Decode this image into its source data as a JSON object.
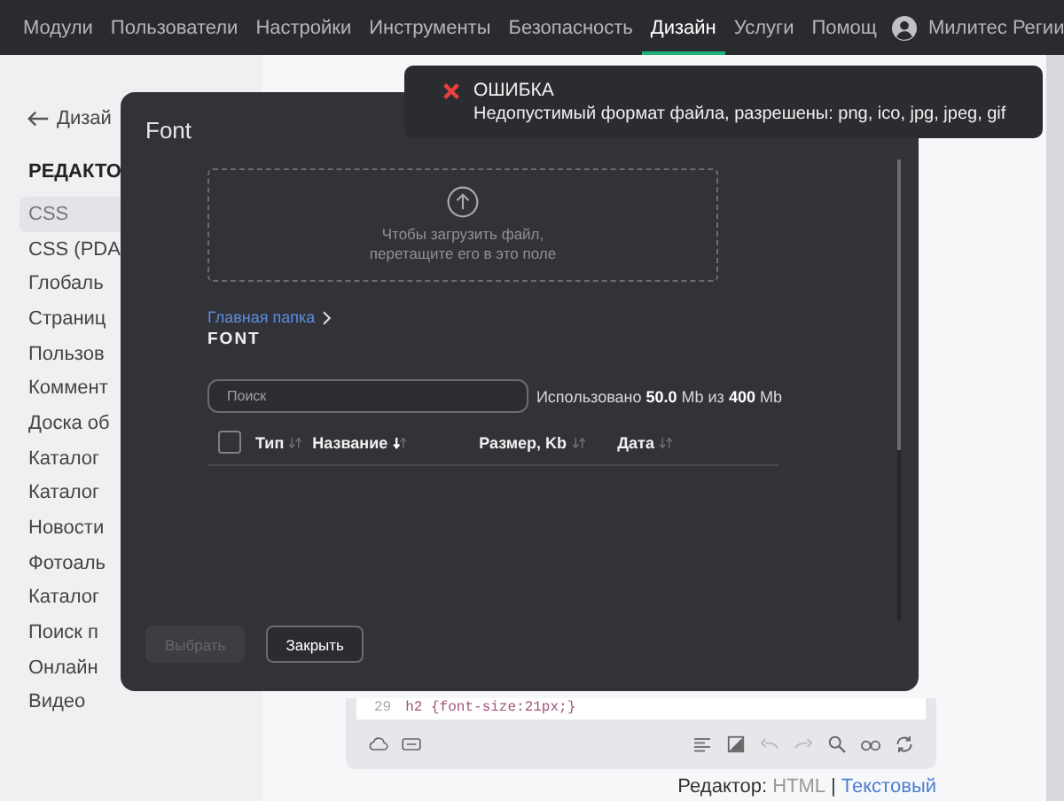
{
  "nav": {
    "items": [
      {
        "label": "Модули",
        "selected": false
      },
      {
        "label": "Пользователи",
        "selected": false
      },
      {
        "label": "Настройки",
        "selected": false
      },
      {
        "label": "Инструменты",
        "selected": false
      },
      {
        "label": "Безопасность",
        "selected": false
      },
      {
        "label": "Дизайн",
        "selected": true
      },
      {
        "label": "Услуги",
        "selected": false
      },
      {
        "label": "Помощ",
        "selected": false
      }
    ],
    "user": {
      "name": "Милитес Регии"
    }
  },
  "back_link": "Дизай",
  "sidebar": {
    "heading": "РЕДАКТО",
    "items": [
      {
        "label": "CSS",
        "selected": true
      },
      {
        "label": "CSS (PDA",
        "selected": false
      },
      {
        "label": "Глобаль",
        "selected": false
      },
      {
        "label": "Страниц",
        "selected": false
      },
      {
        "label": "Пользов",
        "selected": false
      },
      {
        "label": "Коммент",
        "selected": false
      },
      {
        "label": "Доска об",
        "selected": false
      },
      {
        "label": "Каталог",
        "selected": false
      },
      {
        "label": "Каталог",
        "selected": false
      },
      {
        "label": "Новости",
        "selected": false
      },
      {
        "label": "Фотоаль",
        "selected": false
      },
      {
        "label": "Каталог",
        "selected": false
      },
      {
        "label": "Поиск п",
        "selected": false
      },
      {
        "label": "Онлайн",
        "selected": false
      },
      {
        "label": "Видео",
        "selected": false
      }
    ]
  },
  "editor": {
    "line_number": "29",
    "code": "h2 {font-size:21px;}",
    "footer_label": "Редактор:",
    "separator": "|",
    "modes": [
      {
        "label": "HTML",
        "selected": true
      },
      {
        "label": "Текстовый",
        "selected": false
      }
    ]
  },
  "dialog": {
    "title": "Font",
    "dropzone": {
      "lines": [
        "Чтобы загрузить файл,",
        "перетащите его в это поле"
      ]
    },
    "breadcrumb": {
      "link": "Главная папка",
      "current": "FONT"
    },
    "search": {
      "placeholder": "Поиск"
    },
    "usage": "Использовано **50.0** Mb из **400** Mb",
    "table": {
      "select_all_checked": false,
      "columns": [
        {
          "label": "Тип",
          "sorted_descending": false
        },
        {
          "label": "Название",
          "sorted_descending": true
        },
        {
          "label": "Размер, Kb",
          "sorted_descending": false
        },
        {
          "label": "Дата",
          "sorted_descending": false
        }
      ]
    },
    "buttons": [
      {
        "label": "Выбрать",
        "disabled": true
      },
      {
        "label": "Закрыть",
        "disabled": false
      }
    ]
  },
  "toast": {
    "kind": "error",
    "title": "ОШИБКА",
    "message": "Недопустимый формат файла, разрешены: png, ico, jpg, jpeg, gif"
  }
}
